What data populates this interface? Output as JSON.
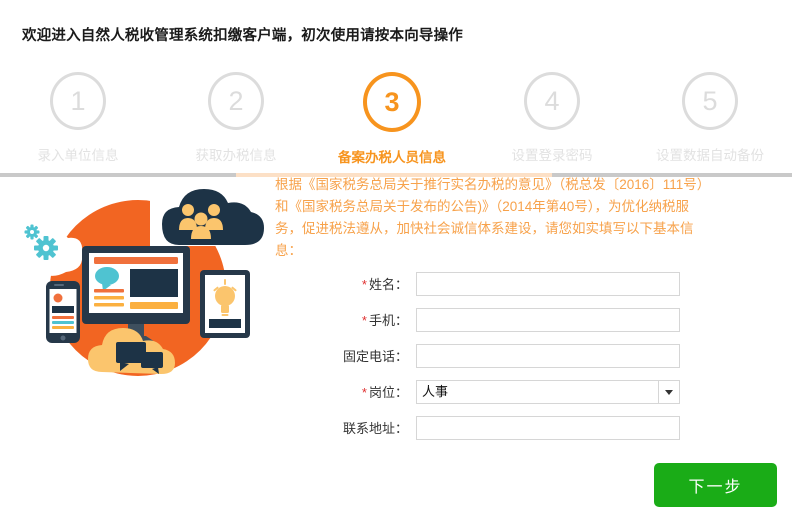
{
  "header": {
    "welcome_title": "欢迎进入自然人税收管理系统扣缴客户端，初次使用请按本向导操作"
  },
  "stepper": {
    "current_step": 3,
    "active_color": "#f7941e",
    "inactive_color": "#dcdcdc",
    "steps": [
      {
        "number": "1",
        "label": "录入单位信息",
        "state": "inactive"
      },
      {
        "number": "2",
        "label": "获取办税信息",
        "state": "inactive"
      },
      {
        "number": "3",
        "label": "备案办税人员信息",
        "state": "current"
      },
      {
        "number": "4",
        "label": "设置登录密码",
        "state": "inactive"
      },
      {
        "number": "5",
        "label": "设置数据自动备份",
        "state": "inactive"
      }
    ]
  },
  "illustration": {
    "name": "devices-cloud-illustration",
    "circle_color": "#f26522",
    "dark_color": "#1d3346",
    "yellow_color": "#fbc56d",
    "teal_color": "#4fc3d1",
    "elements": [
      "monitor",
      "smartphone",
      "tablet",
      "cloud-with-people",
      "cloud-with-chat",
      "gears"
    ]
  },
  "notice": {
    "text": "根据《国家税务总局关于推行实名办税的意见》（税总发〔2016〕111号）和《国家税务总局关于发布的公告)》（2014年第40号），为优化纳税服务，促进税法遵从，加快社会诚信体系建设，请您如实填写以下基本信息：",
    "color": "#f7a24b"
  },
  "form": {
    "fields": [
      {
        "label": "姓名：",
        "required": true,
        "type": "text",
        "value": "",
        "placeholder": ""
      },
      {
        "label": "手机：",
        "required": true,
        "type": "text",
        "value": "",
        "placeholder": ""
      },
      {
        "label": "固定电话：",
        "required": false,
        "type": "text",
        "value": "",
        "placeholder": ""
      },
      {
        "label": "岗位：",
        "required": true,
        "type": "select",
        "value": "人事",
        "placeholder": ""
      },
      {
        "label": "联系地址：",
        "required": false,
        "type": "text",
        "value": "",
        "placeholder": ""
      }
    ]
  },
  "footer": {
    "next_label": "下一步",
    "next_color": "#1aac17"
  }
}
